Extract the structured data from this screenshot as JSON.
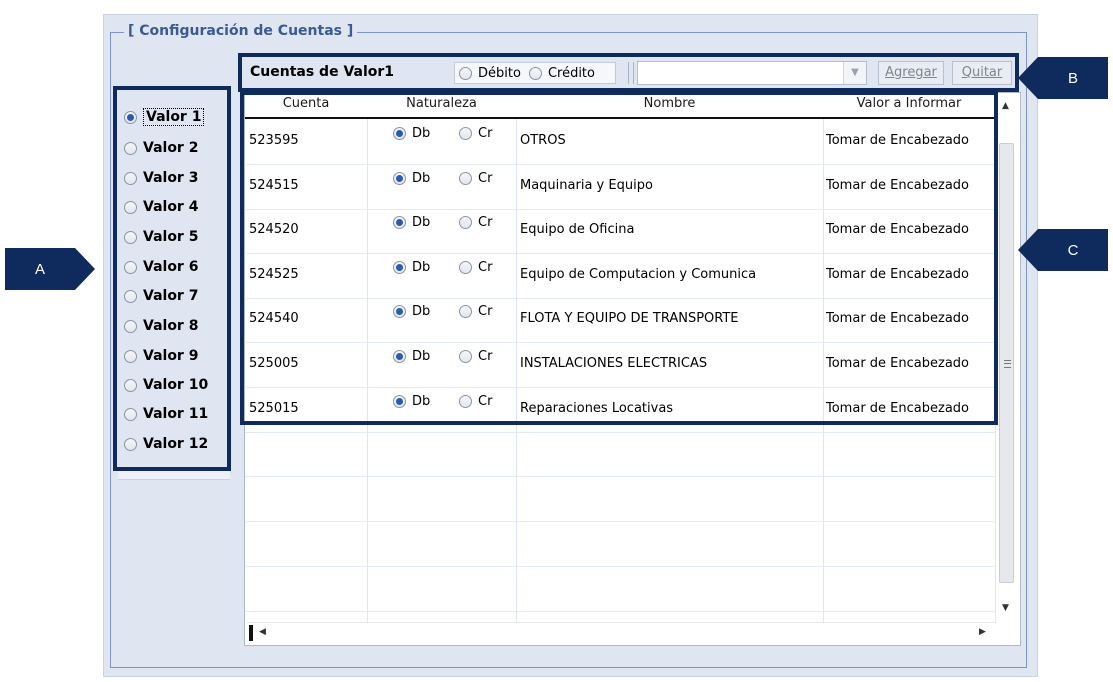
{
  "window": {
    "group_title": "[ Configuración de Cuentas ]"
  },
  "left_list": {
    "items": [
      {
        "label": "Valor 1",
        "checked": true
      },
      {
        "label": "Valor 2",
        "checked": false
      },
      {
        "label": "Valor 3",
        "checked": false
      },
      {
        "label": "Valor 4",
        "checked": false
      },
      {
        "label": "Valor 5",
        "checked": false
      },
      {
        "label": "Valor 6",
        "checked": false
      },
      {
        "label": "Valor 7",
        "checked": false
      },
      {
        "label": "Valor 8",
        "checked": false
      },
      {
        "label": "Valor 9",
        "checked": false
      },
      {
        "label": "Valor 10",
        "checked": false
      },
      {
        "label": "Valor 11",
        "checked": false
      },
      {
        "label": "Valor 12",
        "checked": false
      }
    ]
  },
  "toolbar": {
    "title": "Cuentas de Valor1",
    "debit_label": "Débito",
    "credit_label": "Crédito",
    "combo_value": "",
    "add_label": "Agregar",
    "remove_label": "Quitar"
  },
  "grid": {
    "columns": [
      "Cuenta",
      "Naturaleza",
      "Nombre",
      "Valor a Informar"
    ],
    "db_label": "Db",
    "cr_label": "Cr",
    "rows": [
      {
        "cuenta": "523595",
        "naturaleza": "Db",
        "nombre": "OTROS",
        "valor": "Tomar de Encabezado"
      },
      {
        "cuenta": "524515",
        "naturaleza": "Db",
        "nombre": "Maquinaria y Equipo",
        "valor": "Tomar de Encabezado"
      },
      {
        "cuenta": "524520",
        "naturaleza": "Db",
        "nombre": "Equipo de Oficina",
        "valor": "Tomar de Encabezado"
      },
      {
        "cuenta": "524525",
        "naturaleza": "Db",
        "nombre": "Equipo de Computacion y Comunica",
        "valor": "Tomar de Encabezado"
      },
      {
        "cuenta": "524540",
        "naturaleza": "Db",
        "nombre": "FLOTA Y EQUIPO DE TRANSPORTE",
        "valor": "Tomar de Encabezado"
      },
      {
        "cuenta": "525005",
        "naturaleza": "Db",
        "nombre": "INSTALACIONES ELECTRICAS",
        "valor": "Tomar de Encabezado"
      },
      {
        "cuenta": "525015",
        "naturaleza": "Db",
        "nombre": "Reparaciones Locativas",
        "valor": "Tomar de Encabezado"
      }
    ]
  },
  "callouts": {
    "a": "A",
    "b": "B",
    "c": "C"
  },
  "colors": {
    "callout_bg": "#0f2a5c",
    "panel_bg": "#dfe5f1",
    "title_color": "#3a5a93"
  }
}
